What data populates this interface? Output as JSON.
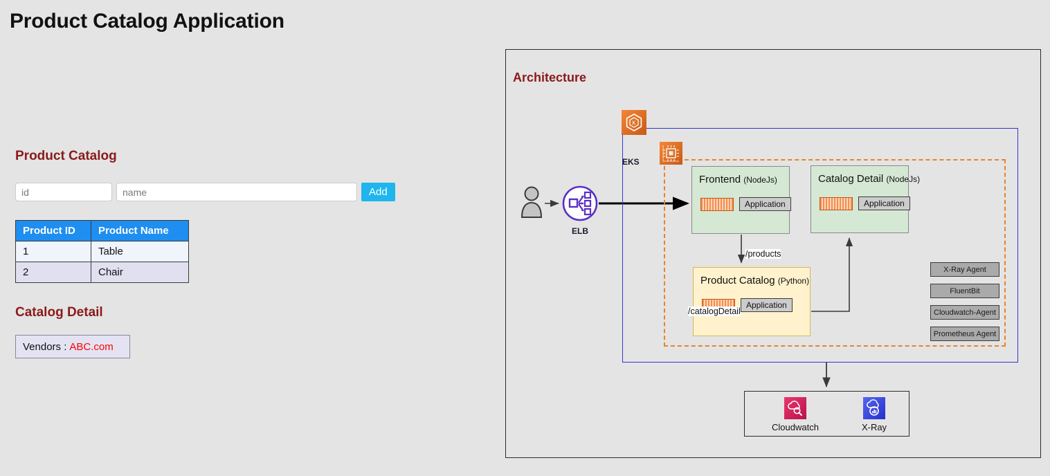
{
  "app": {
    "title": "Product Catalog Application"
  },
  "catalog": {
    "heading": "Product Catalog",
    "form": {
      "id_placeholder": "id",
      "id_value": "",
      "name_placeholder": "name",
      "name_value": "",
      "add_label": "Add"
    },
    "table": {
      "columns": [
        "Product ID",
        "Product Name"
      ],
      "rows": [
        {
          "id": "1",
          "name": "Table"
        },
        {
          "id": "2",
          "name": "Chair"
        }
      ]
    }
  },
  "catalog_detail": {
    "heading": "Catalog Detail",
    "vendors_label": "Vendors :",
    "vendors_value": "ABC.com",
    "vendors_value_color": "#ff0000"
  },
  "architecture": {
    "heading": "Architecture",
    "actor": {
      "name": "user-actor"
    },
    "elb": {
      "label": "ELB"
    },
    "eks": {
      "label": "EKS"
    },
    "services": [
      {
        "name": "Frontend",
        "lang": "(NodeJs)",
        "chip": "Application",
        "fill": "#d5e8d4"
      },
      {
        "name": "Catalog Detail",
        "lang": "(NodeJs)",
        "chip": "Application",
        "fill": "#d5e8d4"
      },
      {
        "name": "Product Catalog",
        "lang": "(Python)",
        "chip": "Application",
        "fill": "#fff2cc"
      }
    ],
    "edges": [
      {
        "label": "/products"
      },
      {
        "label": "/catalogDetail"
      }
    ],
    "agents": [
      "X-Ray Agent",
      "FluentBit",
      "Cloudwatch-Agent",
      "Prometheus Agent"
    ],
    "monitoring": [
      {
        "label": "Cloudwatch",
        "color": "#d6225f"
      },
      {
        "label": "X-Ray",
        "color": "#3d4fe0"
      }
    ],
    "colors": {
      "eks_border": "#3333cc",
      "node_border": "#e8832a",
      "heading": "#8B1A1A"
    }
  }
}
